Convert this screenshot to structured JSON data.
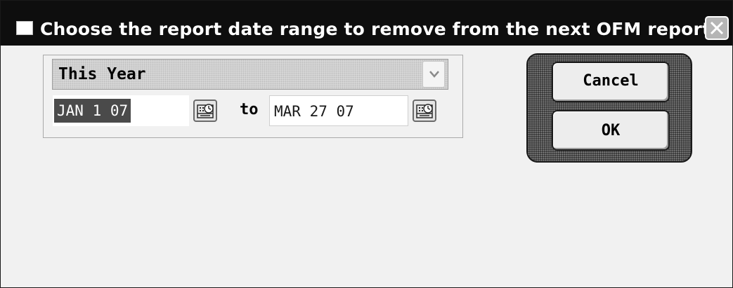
{
  "window": {
    "title": "Choose the report date range to remove from the next OFM report.",
    "close_icon": "close-icon"
  },
  "range": {
    "selected": "This Year",
    "options": [
      "This Year"
    ],
    "start_date": "JAN 1 07",
    "end_date": "MAR 27 07",
    "to_label": "to",
    "calendar_icon": "calendar-icon"
  },
  "buttons": {
    "cancel_label": "Cancel",
    "ok_label": "OK"
  },
  "colors": {
    "titlebar": "#0e0e0e",
    "window_bg": "#f1f1f1",
    "selection": "#4a4a4a"
  }
}
